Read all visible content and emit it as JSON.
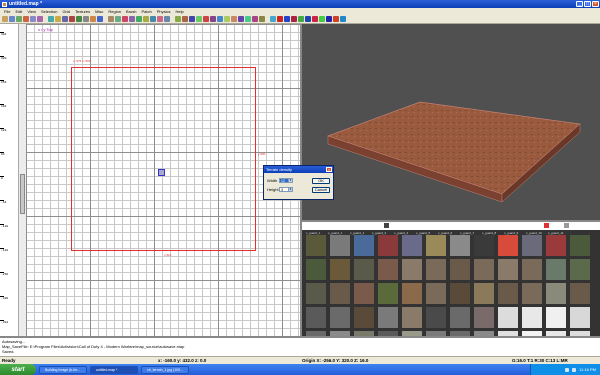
{
  "window": {
    "title": "untitled.map *",
    "minimize": "_",
    "maximize": "□",
    "close": "×"
  },
  "menu": [
    "File",
    "Edit",
    "View",
    "Selection",
    "Grid",
    "Textures",
    "Misc",
    "Region",
    "Brush",
    "Patch",
    "Physics",
    "Help"
  ],
  "toolbar": {
    "colors": [
      "#c8a060",
      "#6688cc",
      "#66aa66",
      "#cc6644",
      "#8888cc",
      "#aa66aa",
      "#44aaaa",
      "#ccaa44",
      "#6666aa",
      "#aa4444",
      "#448844",
      "#888888",
      "#cc8844",
      "#4466cc",
      "#aa8866",
      "#66aa88",
      "#cc4466",
      "#8866aa",
      "#44aa66",
      "#aaaa44",
      "#4488aa",
      "#cc6688",
      "#6688aa",
      "#88aa44",
      "#aa6644",
      "#4444aa",
      "#66cc66",
      "#cc4444",
      "#884488",
      "#4488cc",
      "#aacc66",
      "#cc8866",
      "#6644aa",
      "#44cc88",
      "#aa4488",
      "#888844",
      "#44aacc",
      "#cc2222",
      "#2244cc",
      "#aa2244",
      "#44aa44",
      "#2244aa",
      "#cc2244",
      "#44cc44",
      "#2222aa",
      "#cc4422",
      "#2288cc"
    ]
  },
  "view2d": {
    "label": "x / y Top",
    "ruler_labels": [
      "384",
      "320",
      "256",
      "192",
      "128",
      "64",
      "0",
      "-64",
      "-128",
      "-192",
      "-256",
      "-320",
      "-384",
      "-448"
    ],
    "dim_top": "x:-576  x:-500",
    "dim_right": "y:600",
    "dim_bottom": "x:512"
  },
  "dialog": {
    "title": "Terrain density",
    "width_label": "Width",
    "width_value": "12",
    "height_label": "Height",
    "height_value": "3",
    "ok": "OK",
    "cancel": "Cancel",
    "close": "×",
    "arrow": "▾"
  },
  "textures": {
    "labels": [
      "c_guard_1",
      "c_guard_1",
      "c_guard_1",
      "c_guard_3",
      "c_guard_4",
      "c_guard_5",
      "c_guard_6",
      "c_guard_7",
      "c_guard_8",
      "c_guard_9",
      "c_guard_10",
      "c_guard_11"
    ],
    "tiles": [
      "#5a5a3a",
      "#7a7a7a",
      "#4a6a9a",
      "#8a3a3a",
      "#6a6a8a",
      "#9a8a5a",
      "#8a8a8a",
      "#3a3a3a",
      "#d84a3a",
      "#6a6a7a",
      "#9a3a3a",
      "#4a5a3a",
      "#4a5a3a",
      "#6a5a3a",
      "#5a5a4a",
      "#7a5a4a",
      "#8a7a6a",
      "#7a6a5a",
      "#6a5a4a",
      "#7a6a5a",
      "#8a7a6a",
      "#7a6a5a",
      "#6a7a6a",
      "#5a6a4a",
      "#5a5a4a",
      "#6a5a4a",
      "#7a5a4a",
      "#5a6a3a",
      "#8a6a4a",
      "#7a6a5a",
      "#5a4a3a",
      "#8a7a5a",
      "#6a5a4a",
      "#7a6a5a",
      "#8a8a7a",
      "#6a5a4a",
      "#5a5a5a",
      "#6a6a6a",
      "#5a4a3a",
      "#7a7a7a",
      "#8a7a6a",
      "#4a4a4a",
      "#6a6a6a",
      "#7a6a6a",
      "#dcdcdc",
      "#e8e8e8",
      "#f0f0f0",
      "#d8d8d8",
      "#6a6a6a",
      "#8a8a8a",
      "#7a7a6a",
      "#5a5a5a",
      "#9a9a8a",
      "#7a7a7a",
      "#6a6a6a",
      "#8a8a8a",
      "#e0e0e0",
      "#f4f4f4",
      "#e8e8e8",
      "#dcdcdc"
    ]
  },
  "console": {
    "lines": [
      "Autosaving...",
      "Map_SaveFile: E:\\Program Files\\Activision\\Call of Duty 4 - Modern Warfare\\map_source\\autosave.map",
      "Saved."
    ]
  },
  "status": {
    "ready": "Ready",
    "xyz": "x: -160.0  y: 432.0  z: 0.0",
    "origin": "Origin X: -256.0  Y: 320.0  Z: 16.0",
    "grid": "G:16.0 T:1 R:30 C:13 L:MR"
  },
  "taskbar": {
    "start": "start",
    "tasks": [
      "Building Image (b-fer...",
      "untitled.map *",
      "cb_terrain_1.jpg (100..."
    ],
    "clock": "11:16 PM"
  },
  "colors": {
    "brush": "#e03030",
    "view3d_bg": "#505050",
    "terrain_top": "#9a5a3e",
    "terrain_side": "#7a4030"
  }
}
